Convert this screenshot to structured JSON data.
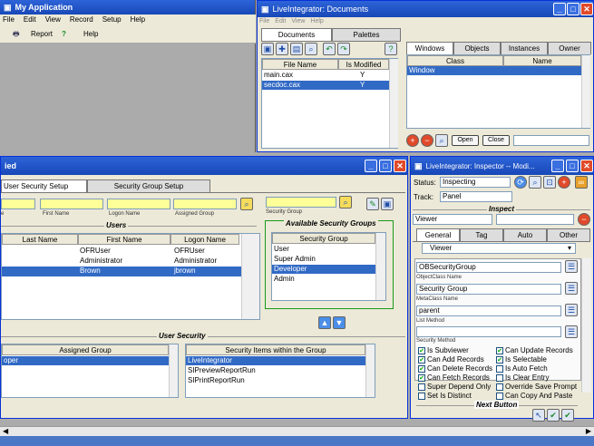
{
  "main": {
    "title": "My Application",
    "menu": [
      "File",
      "Edit",
      "View",
      "Record",
      "Setup",
      "Help"
    ],
    "toolbar": {
      "report": "Report",
      "help": "Help"
    }
  },
  "users": {
    "title": "ied",
    "tabs": [
      "User Security Setup",
      "Security Group Setup"
    ],
    "field_labels": [
      "e",
      "First Name",
      "Logon Name",
      "Assigned Group"
    ],
    "security_group_label": "Security Group",
    "users_heading": "Users",
    "columns": [
      "Last Name",
      "First Name",
      "Logon Name"
    ],
    "rows": [
      [
        "",
        "OFRUser",
        "OFRUser"
      ],
      [
        "",
        "Administrator",
        "Administrator"
      ],
      [
        "",
        "Brown",
        "jbrown"
      ]
    ],
    "available_heading": "Available Security Groups",
    "groups_column": "Security Group",
    "groups": [
      "User",
      "Super Admin",
      "Developer",
      "Admin"
    ],
    "user_security_heading": "User Security",
    "assigned_column": "Assigned Group",
    "assigned_rows": [
      "oper"
    ],
    "items_column": "Security Items within the Group",
    "items": [
      "LiveIntegrator",
      "SIPreviewReportRun",
      "SIPrintReportRun"
    ]
  },
  "docs": {
    "title": "LiveIntegrator: Documents",
    "menu": [
      "File",
      "Edit",
      "View",
      "Help"
    ],
    "tabs": [
      "Documents",
      "Palettes"
    ],
    "columns": [
      "File Name",
      "Is Modified"
    ],
    "rows": [
      [
        "main.cax",
        "Y"
      ],
      [
        "secdoc.cax",
        "Y"
      ]
    ],
    "right_tabs": [
      "Windows",
      "Objects",
      "Instances",
      "Owner"
    ],
    "right_columns": [
      "Class",
      "Name"
    ],
    "right_rows": [
      "Window"
    ],
    "open": "Open",
    "close": "Close"
  },
  "inspector": {
    "title": "LiveIntegrator: Inspector -- Modi...",
    "status_label": "Status:",
    "status_value": "Inspecting",
    "track_label": "Track:",
    "track_value": "Panel",
    "inspect_heading": "Inspect",
    "object_value": "Viewer",
    "tabs": [
      "General",
      "Tag",
      "Auto",
      "Other"
    ],
    "select_value": "Viewer",
    "fields": [
      {
        "value": "OBSecurityGroup",
        "label": "ObjectClass Name"
      },
      {
        "value": "Security Group",
        "label": "MetaClass Name"
      },
      {
        "value": "parent",
        "label": "List Method"
      },
      {
        "value": "",
        "label": "Security Method"
      }
    ],
    "checks_left": [
      {
        "t": "Is Subviewer",
        "c": true
      },
      {
        "t": "Can Add Records",
        "c": true
      },
      {
        "t": "Can Delete Records",
        "c": true
      },
      {
        "t": "Can Fetch Records",
        "c": true
      },
      {
        "t": "Super Depend Only",
        "c": false
      },
      {
        "t": "Set Is Distinct",
        "c": false
      }
    ],
    "checks_right": [
      {
        "t": "Can Update Records",
        "c": true
      },
      {
        "t": "Is Selectable",
        "c": true
      },
      {
        "t": "Is Auto Fetch",
        "c": false
      },
      {
        "t": "Is Clear Entry",
        "c": false
      },
      {
        "t": "Override Save Prompt",
        "c": false
      },
      {
        "t": "Can Copy And Paste",
        "c": false
      }
    ],
    "next_heading": "Next Button"
  },
  "colors": {
    "title_blue": "#2d64d8",
    "selection": "#316ac5",
    "field_yellow": "#ffff99"
  }
}
